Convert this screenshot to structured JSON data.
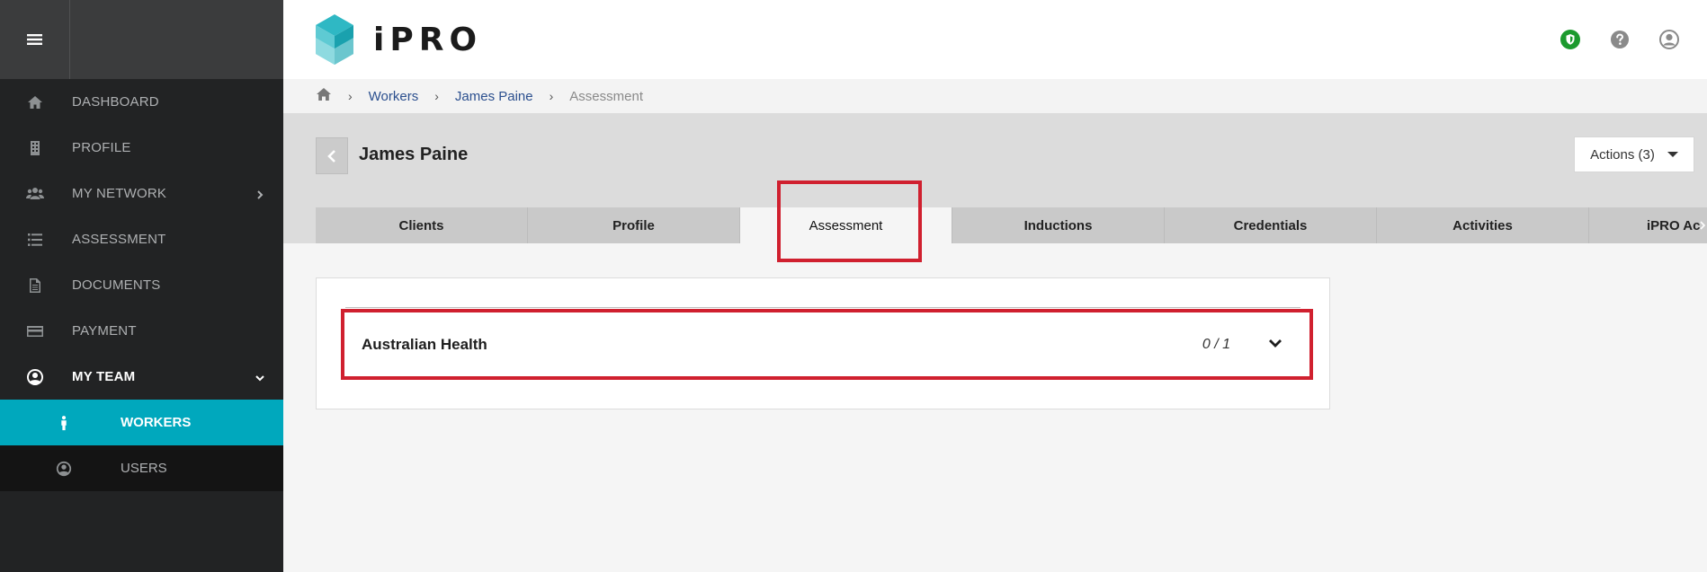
{
  "sidebar": {
    "items": [
      {
        "label": "DASHBOARD",
        "icon": "home-icon"
      },
      {
        "label": "PROFILE",
        "icon": "building-icon"
      },
      {
        "label": "MY NETWORK",
        "icon": "users-icon"
      },
      {
        "label": "ASSESSMENT",
        "icon": "list-icon"
      },
      {
        "label": "DOCUMENTS",
        "icon": "document-icon"
      },
      {
        "label": "PAYMENT",
        "icon": "credit-card-icon"
      },
      {
        "label": "MY TEAM",
        "icon": "user-circle-icon"
      }
    ],
    "subitems": [
      {
        "label": "WORKERS",
        "icon": "person-icon"
      },
      {
        "label": "USERS",
        "icon": "user-circle-icon"
      }
    ],
    "colors": {
      "active": "#00a8bd",
      "background": "#222324"
    }
  },
  "header": {
    "logo_text": "iPRO"
  },
  "breadcrumb": {
    "items": [
      "Workers",
      "James Paine"
    ],
    "current": "Assessment"
  },
  "worker": {
    "name": "James Paine",
    "actions_label": "Actions (3)"
  },
  "tabs": [
    "Clients",
    "Profile",
    "Assessment",
    "Inductions",
    "Credentials",
    "Activities",
    "iPRO Ac"
  ],
  "active_tab": "Assessment",
  "assessment": {
    "title": "Australian Health",
    "count": "0 / 1"
  }
}
